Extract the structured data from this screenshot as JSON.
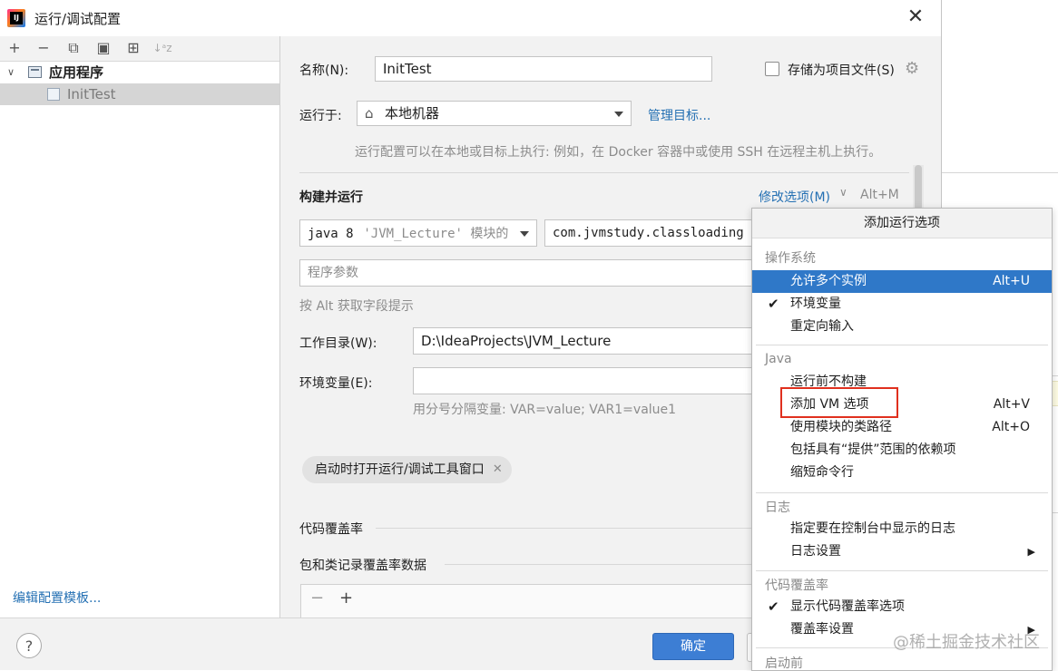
{
  "window": {
    "title": "运行/调试配置",
    "close_glyph": "✕"
  },
  "left_toolbar": {
    "add": "+",
    "remove": "−",
    "copy": "⧉",
    "save": "▣",
    "move": "⊞",
    "sort": "↓ᵃz"
  },
  "tree": [
    {
      "label": "应用程序",
      "expanded": true,
      "bold": true
    },
    {
      "label": "InitTest",
      "selected": true
    }
  ],
  "edit_templates_link": "编辑配置模板...",
  "form": {
    "name_label": "名称(N):",
    "name_value": "InitTest",
    "store_as_project_file": "存储为项目文件(S)",
    "run_on_label": "运行于:",
    "run_on_value": "本地机器",
    "manage_targets": "管理目标...",
    "run_on_hint": "运行配置可以在本地或目标上执行: 例如，在 Docker 容器中或使用 SSH 在远程主机上执行。",
    "build_run_title": "构建并运行",
    "modify_options": "修改选项(M)",
    "modify_shortcut": "Alt+M",
    "jdk_value": "java 8",
    "jdk_module": "'JVM_Lecture' 模块的",
    "main_class_value": "com.jvmstudy.classloading",
    "program_args_placeholder": "程序参数",
    "alt_hint": "按 Alt 获取字段提示",
    "workdir_label": "工作目录(W):",
    "workdir_value": "D:\\IdeaProjects\\JVM_Lecture",
    "env_label": "环境变量(E):",
    "env_value": "",
    "env_hint": "用分号分隔变量: VAR=value; VAR1=value1",
    "chip_label": "启动时打开运行/调试工具窗口",
    "coverage_title": "代码覆盖率",
    "coverage_pkg_title": "包和类记录覆盖率数据"
  },
  "footer": {
    "help": "?",
    "ok": "确定"
  },
  "popup": {
    "title": "添加运行选项",
    "groups": [
      {
        "name": "操作系统",
        "items": [
          {
            "label": "允许多个实例",
            "shortcut": "Alt+U",
            "highlighted": true
          },
          {
            "label": "环境变量",
            "checked": true
          },
          {
            "label": "重定向输入"
          }
        ]
      },
      {
        "name": "Java",
        "items": [
          {
            "label": "运行前不构建"
          },
          {
            "label": "添加 VM 选项",
            "shortcut": "Alt+V"
          },
          {
            "label": "使用模块的类路径",
            "shortcut": "Alt+O"
          },
          {
            "label": "包括具有“提供”范围的依赖项"
          },
          {
            "label": "缩短命令行"
          }
        ]
      },
      {
        "name": "日志",
        "items": [
          {
            "label": "指定要在控制台中显示的日志"
          },
          {
            "label": "日志设置",
            "submenu": true
          }
        ]
      },
      {
        "name": "代码覆盖率",
        "items": [
          {
            "label": "显示代码覆盖率选项",
            "checked": true
          },
          {
            "label": "覆盖率设置",
            "submenu": true
          }
        ]
      },
      {
        "name": "启动前",
        "items": []
      }
    ]
  },
  "watermark": "@稀土掘金技术社区",
  "colors": {
    "accent": "#2f78c8",
    "link": "#2470b3",
    "ok_button": "#3d7ed4",
    "highlight_box": "#e0301e"
  }
}
